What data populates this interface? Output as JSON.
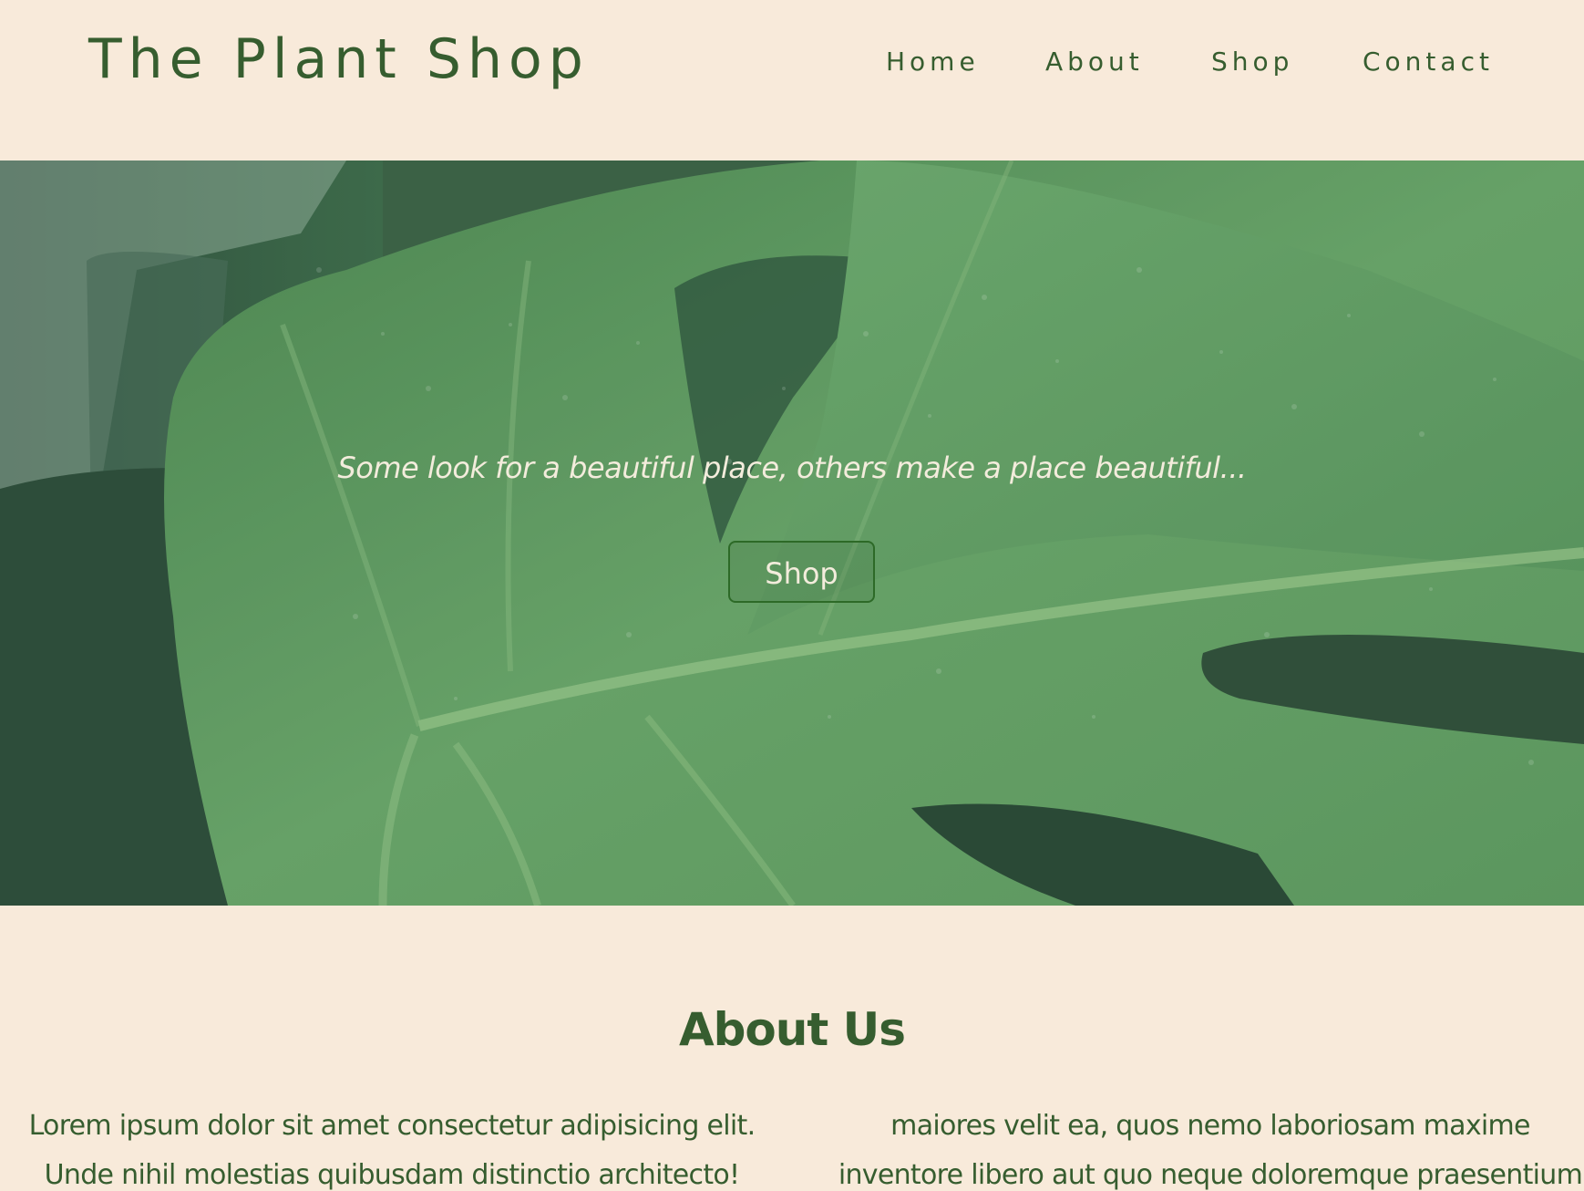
{
  "header": {
    "brand": "The Plant Shop",
    "nav": [
      {
        "label": "Home"
      },
      {
        "label": "About"
      },
      {
        "label": "Shop"
      },
      {
        "label": "Contact"
      }
    ]
  },
  "hero": {
    "tagline": "Some look for a beautiful place, others make a place beautiful...",
    "button_label": "Shop"
  },
  "about": {
    "title": "About Us",
    "left_text": "Lorem ipsum dolor sit amet consectetur adipisicing elit. Unde nihil molestias quibusdam distinctio architecto! Rem eum quis ipsa dolibus?",
    "right_text": "maiores velit ea, quos nemo laboriosam maxime inventore libero aut quo neque doloremque praesentium doloribus sint quia ?"
  },
  "colors": {
    "background": "#f8eada",
    "brand_green": "#365d2f",
    "button_border": "#2d6a27",
    "hero_text": "#f3ecdc"
  }
}
